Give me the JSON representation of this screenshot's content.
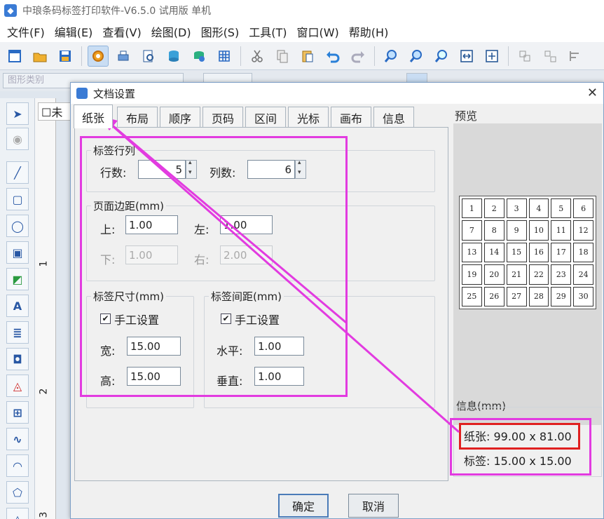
{
  "app": {
    "title": "中琅条码标签打印软件-V6.5.0 试用版 单机",
    "menu": [
      "文件(F)",
      "编辑(E)",
      "查看(V)",
      "绘图(D)",
      "图形(S)",
      "工具(T)",
      "窗口(W)",
      "帮助(H)"
    ],
    "field_hint": "图形类别",
    "doc_tab": "未",
    "ruler_numbers": [
      "1",
      "2",
      "3"
    ]
  },
  "dialog": {
    "title": "文档设置",
    "close": "✕",
    "tabs": [
      "纸张",
      "布局",
      "顺序",
      "页码",
      "区间",
      "光标",
      "画布",
      "信息"
    ],
    "selected_tab": 0,
    "layout": {
      "rowcol_group": "标签行列",
      "rows_label": "行数:",
      "rows_value": "5",
      "cols_label": "列数:",
      "cols_value": "6",
      "margin_group": "页面边距(mm)",
      "top_label": "上:",
      "top_value": "1.00",
      "left_label": "左:",
      "left_value": "1.00",
      "bottom_label": "下:",
      "bottom_value": "1.00",
      "right_label": "右:",
      "right_value": "2.00",
      "size_group": "标签尺寸(mm)",
      "size_manual": "手工设置",
      "width_label": "宽:",
      "width_value": "15.00",
      "height_label": "高:",
      "height_value": "15.00",
      "gap_group": "标签间距(mm)",
      "gap_manual": "手工设置",
      "hgap_label": "水平:",
      "hgap_value": "1.00",
      "vgap_label": "垂直:",
      "vgap_value": "1.00"
    },
    "preview_label": "预览",
    "preview_cells": [
      "1",
      "2",
      "3",
      "4",
      "5",
      "6",
      "7",
      "8",
      "9",
      "10",
      "11",
      "12",
      "13",
      "14",
      "15",
      "16",
      "17",
      "18",
      "19",
      "20",
      "21",
      "22",
      "23",
      "24",
      "25",
      "26",
      "27",
      "28",
      "29",
      "30"
    ],
    "info_label": "信息(mm)",
    "info_paper": "纸张: 99.00 x 81.00",
    "info_label_size": "标签: 15.00 x 15.00",
    "ok": "确定",
    "cancel": "取消"
  },
  "colors": {
    "highlight_pink": "#e23be0",
    "highlight_red": "#e02020"
  }
}
